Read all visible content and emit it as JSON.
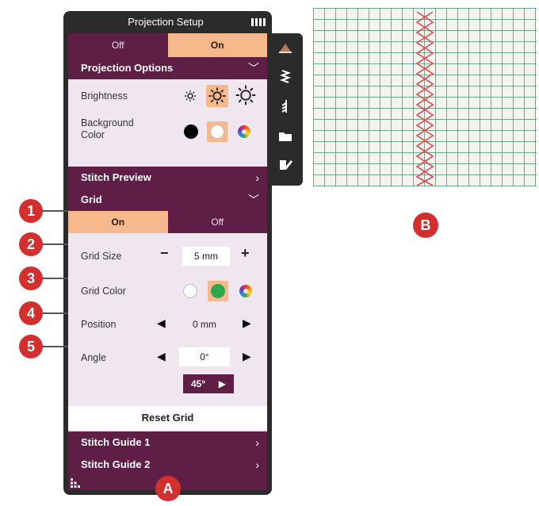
{
  "window": {
    "title": "Projection Setup"
  },
  "projection_toggle": {
    "off_label": "Off",
    "on_label": "On",
    "selected": "On"
  },
  "projection_options": {
    "header": "Projection Options",
    "brightness_label": "Brightness",
    "background_color_label": "Background\nColor"
  },
  "stitch_preview": {
    "header": "Stitch Preview"
  },
  "grid": {
    "header": "Grid",
    "on_label": "On",
    "off_label": "Off",
    "selected": "On",
    "grid_size_label": "Grid Size",
    "grid_size_value": "5 mm",
    "grid_color_label": "Grid Color",
    "position_label": "Position",
    "position_value": "0 mm",
    "angle_label": "Angle",
    "angle_value": "0°",
    "angle_step_label": "45°",
    "reset_label": "Reset Grid"
  },
  "stitch_guides": {
    "guide1": "Stitch Guide 1",
    "guide2": "Stitch Guide 2"
  },
  "callouts": {
    "c1": "1",
    "c2": "2",
    "c3": "3",
    "c4": "4",
    "c5": "5",
    "a": "A",
    "b": "B"
  },
  "icons": {
    "brightness_low": "sun-small-icon",
    "brightness_mid": "sun-medium-icon",
    "brightness_high": "sun-large-icon",
    "bg_black": "black-circle-icon",
    "bg_white": "white-circle-icon",
    "bg_custom": "color-wheel-icon",
    "grid_white": "white-circle-icon",
    "grid_green": "green-circle-icon",
    "grid_custom": "color-wheel-icon",
    "sidebar": [
      "sewing-foot-icon",
      "zigzag-stitch-icon",
      "stitch-icon",
      "folder-icon",
      "edit-icon"
    ],
    "menu": "dots-menu-icon",
    "battery": "battery-icon"
  },
  "colors": {
    "accent": "#f7b98b",
    "header_bg": "#5e1e45",
    "content_bg": "#efe6ef",
    "callout_red": "#d32f2f",
    "grid_line_green": "#3c966e",
    "stitch_red": "#e0484d"
  }
}
